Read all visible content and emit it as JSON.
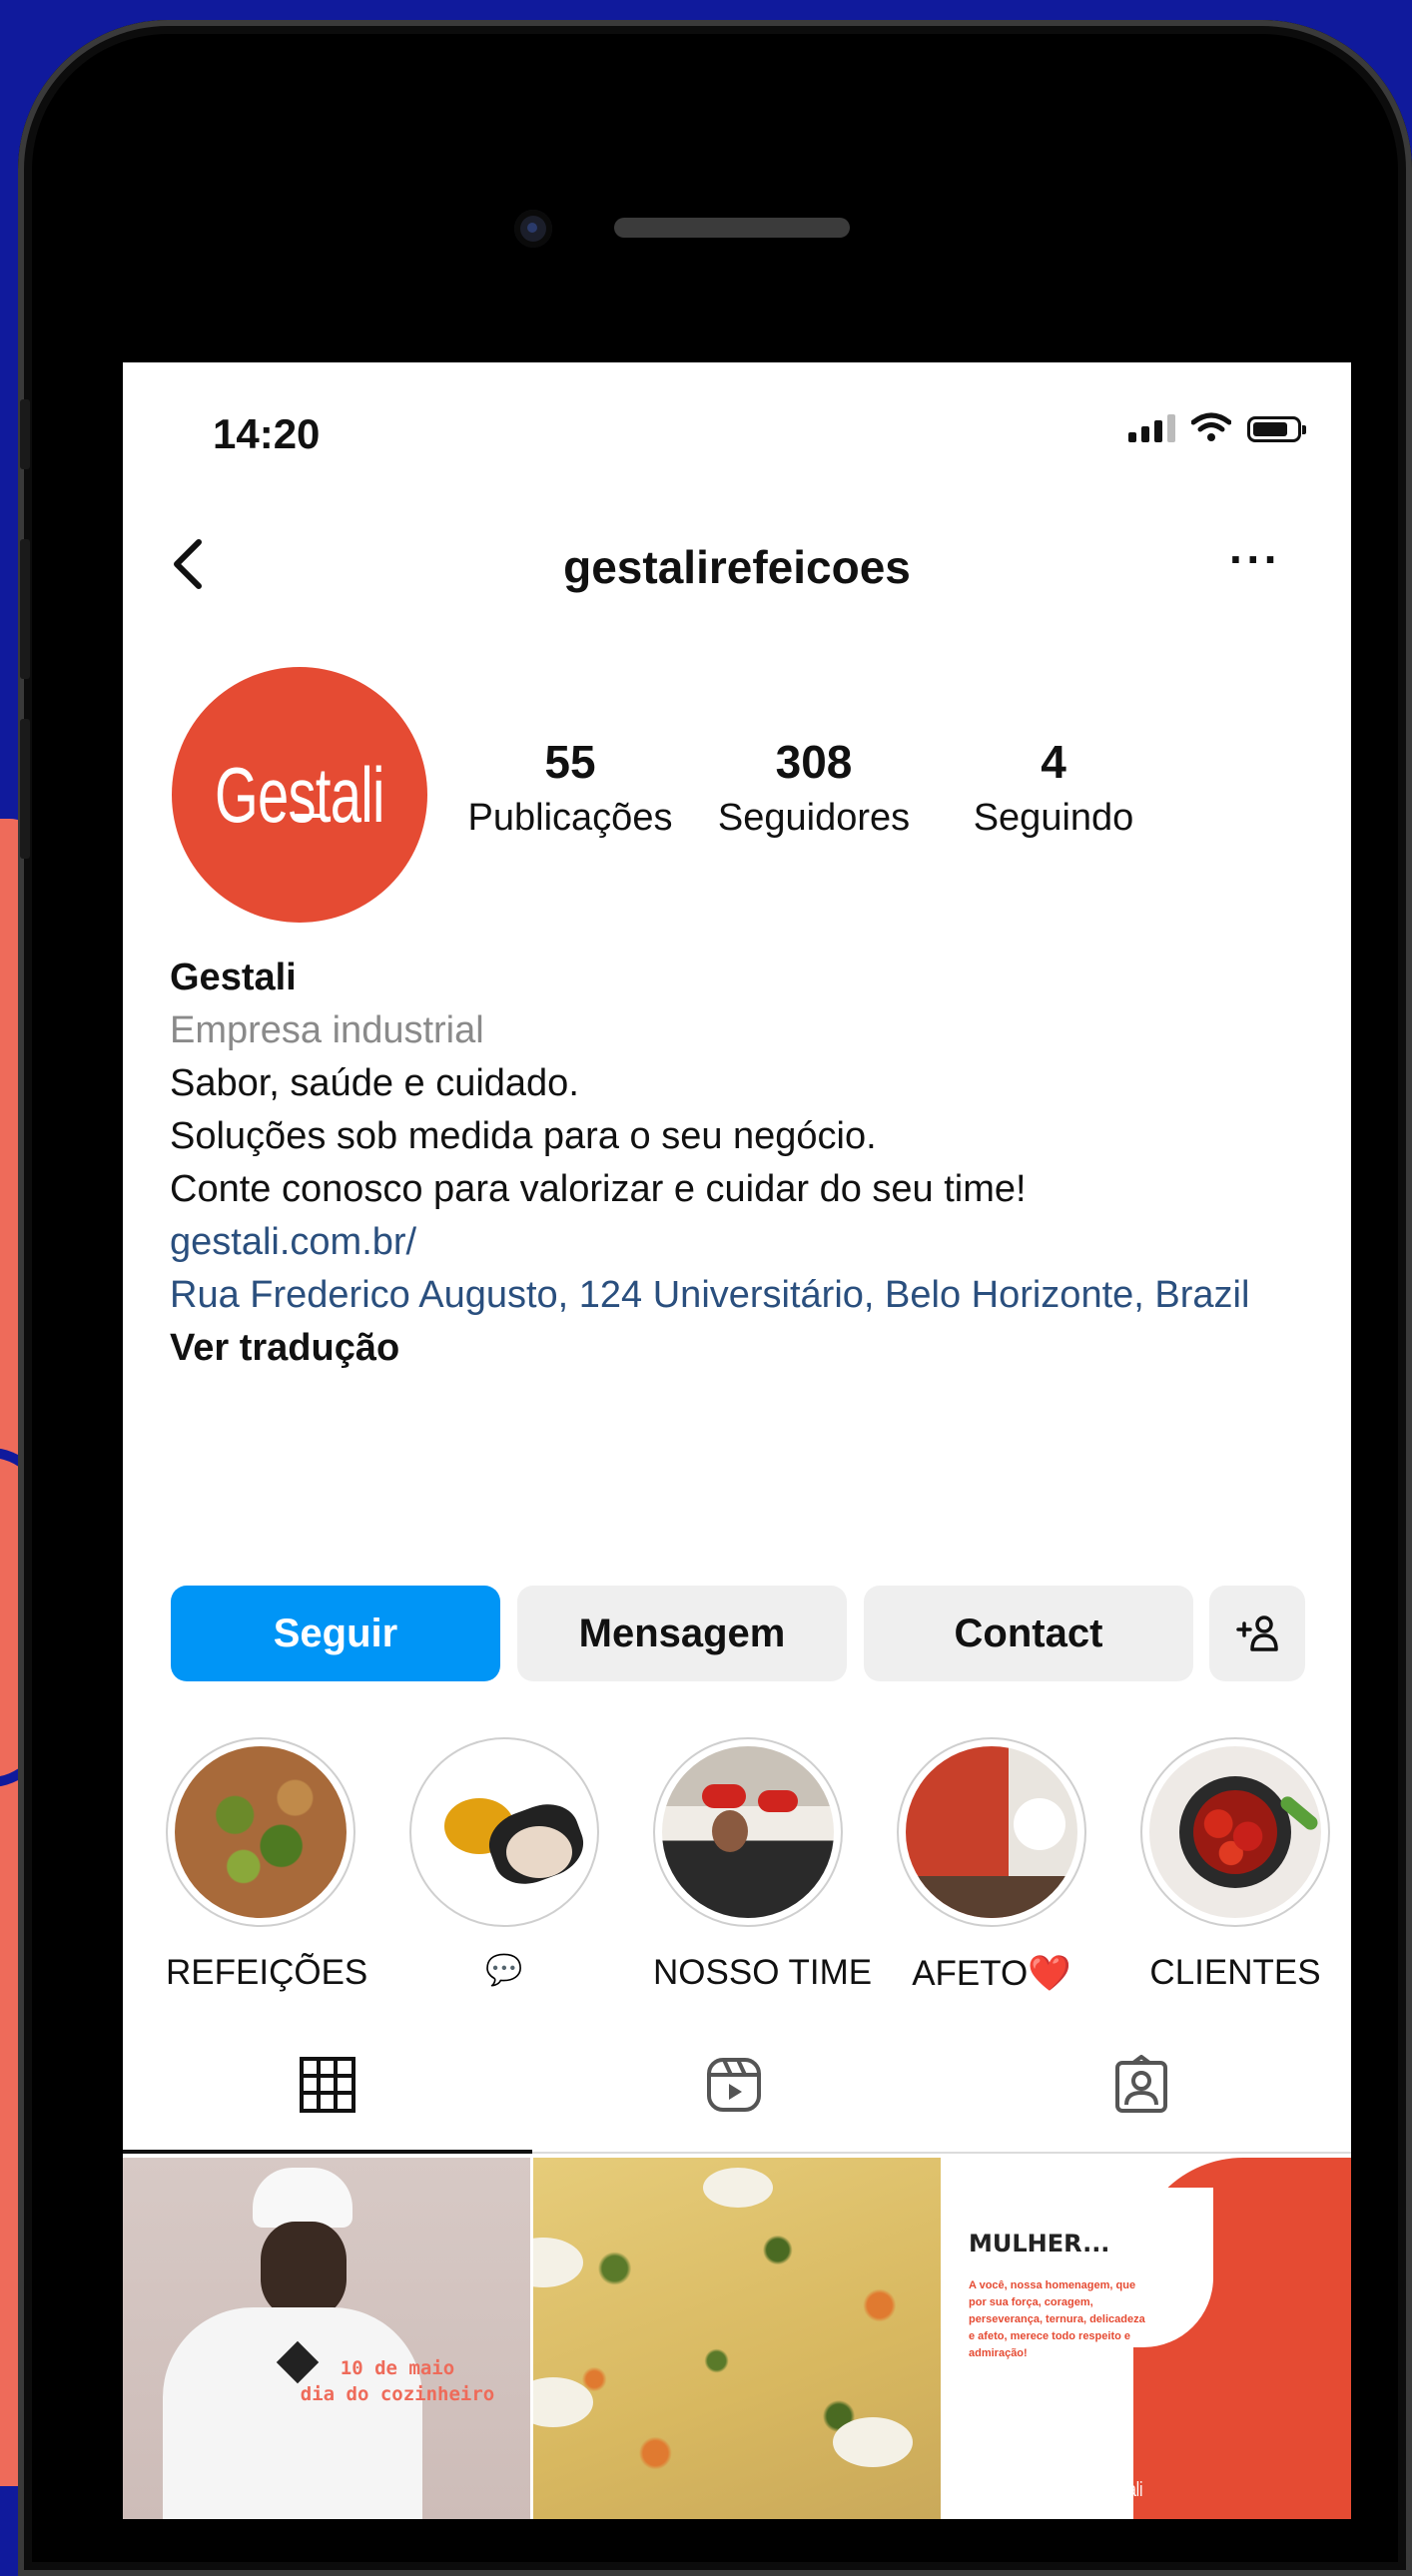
{
  "status": {
    "time": "14:20"
  },
  "header": {
    "username": "gestalirefeicoes",
    "more": "···"
  },
  "profile": {
    "avatar_text": "Gestali",
    "brand_color": "#e54b33",
    "stats": [
      {
        "value": "55",
        "label": "Publicações"
      },
      {
        "value": "308",
        "label": "Seguidores"
      },
      {
        "value": "4",
        "label": "Seguindo"
      }
    ]
  },
  "bio": {
    "name": "Gestali",
    "category": "Empresa industrial",
    "lines": [
      "Sabor, saúde e cuidado.",
      "Soluções sob medida para o seu negócio.",
      "Conte conosco para valorizar e cuidar do seu time!"
    ],
    "website": "gestali.com.br/",
    "address": "Rua Frederico Augusto, 124 Universitário, Belo Horizonte, Brazil",
    "translate": "Ver tradução"
  },
  "actions": {
    "follow": "Seguir",
    "message": "Mensagem",
    "contact": "Contact",
    "add_user_icon": "add-person-icon",
    "follow_color": "#0095f6"
  },
  "highlights": [
    {
      "label": "REFEIÇÕES"
    },
    {
      "label": "💬"
    },
    {
      "label": "NOSSO TIME"
    },
    {
      "label": "AFETO❤️"
    },
    {
      "label": "CLIENTES"
    }
  ],
  "tabs": [
    {
      "icon": "grid-icon"
    },
    {
      "icon": "reels-icon"
    },
    {
      "icon": "tagged-icon"
    }
  ],
  "posts": [
    {
      "text": "10 de maio\ndia do cozinheiro"
    },
    {
      "text": ""
    },
    {
      "title": "MULHER...",
      "body": "A você, nossa homenagem, que por sua força, coragem, perseverança, ternura, delicadeza e afeto, merece todo respeito e admiração!",
      "logo": "Gestali"
    }
  ]
}
